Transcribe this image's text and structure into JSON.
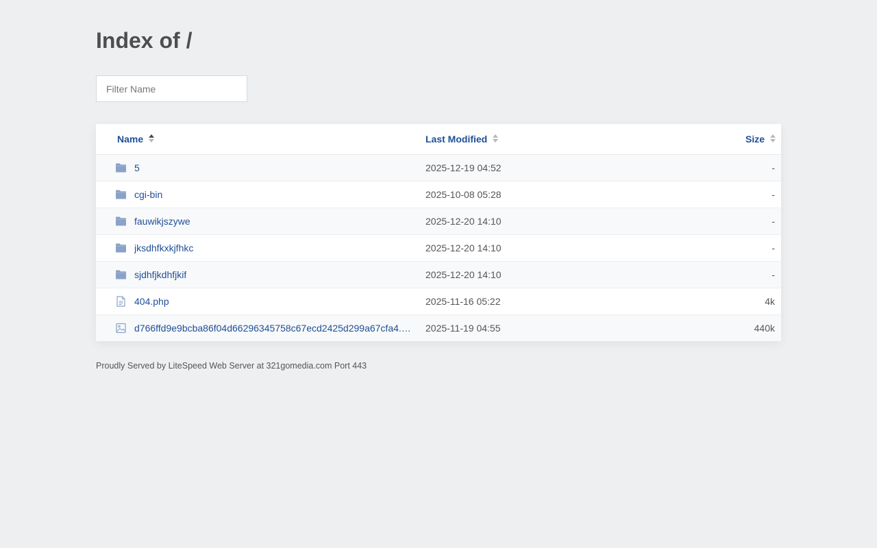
{
  "page": {
    "title": "Index of /"
  },
  "filter": {
    "placeholder": "Filter Name",
    "value": ""
  },
  "table": {
    "headers": {
      "name": "Name",
      "last_modified": "Last Modified",
      "size": "Size"
    },
    "rows": [
      {
        "icon": "folder-icon",
        "name": "5",
        "modified": "2025-12-19 04:52",
        "size": "-"
      },
      {
        "icon": "folder-icon",
        "name": "cgi-bin",
        "modified": "2025-10-08 05:28",
        "size": "-"
      },
      {
        "icon": "folder-icon",
        "name": "fauwikjszywe",
        "modified": "2025-12-20 14:10",
        "size": "-"
      },
      {
        "icon": "folder-icon",
        "name": "jksdhfkxkjfhkc",
        "modified": "2025-12-20 14:10",
        "size": "-"
      },
      {
        "icon": "folder-icon",
        "name": "sjdhfjkdhfjkif",
        "modified": "2025-12-20 14:10",
        "size": "-"
      },
      {
        "icon": "file-text-icon",
        "name": "404.php",
        "modified": "2025-11-16 05:22",
        "size": "4k"
      },
      {
        "icon": "image-file-icon",
        "name": "d766ffd9e9bcba86f04d66296345758c67ecd2425d299a67cfa4.p...",
        "modified": "2025-11-19 04:55",
        "size": "440k"
      }
    ]
  },
  "footer": {
    "text": "Proudly Served by LiteSpeed Web Server at 321gomedia.com Port 443"
  },
  "colors": {
    "background": "#eeeff1",
    "link": "#1f4f96",
    "icon": "#8aa2c8",
    "text": "#555555"
  }
}
